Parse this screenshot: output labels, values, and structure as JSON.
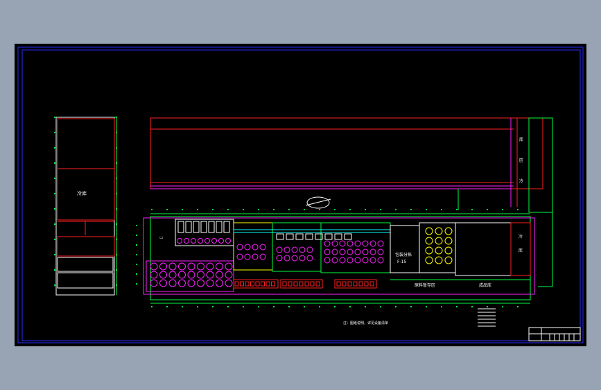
{
  "drawing": {
    "background": "#000000",
    "frame_color": "#2a2aff",
    "layer_colors": {
      "red": "#ff2020",
      "green": "#00ff40",
      "magenta": "#ff20ff",
      "white": "#ffffff",
      "yellow": "#ffff00",
      "cyan": "#00ffff",
      "blue": "#3030ff"
    },
    "labels": {
      "left_room": "冷库",
      "zone_mid": "包装分拣",
      "zone_mid_code": "F-15",
      "room_lower_a": "原料暂存区",
      "room_lower_b": "成品库",
      "side_text_1": "冷",
      "side_text_2": "库",
      "note_line": "注：图纸说明，详见设备清单",
      "top_room_1": "库",
      "top_room_2": "区"
    }
  }
}
